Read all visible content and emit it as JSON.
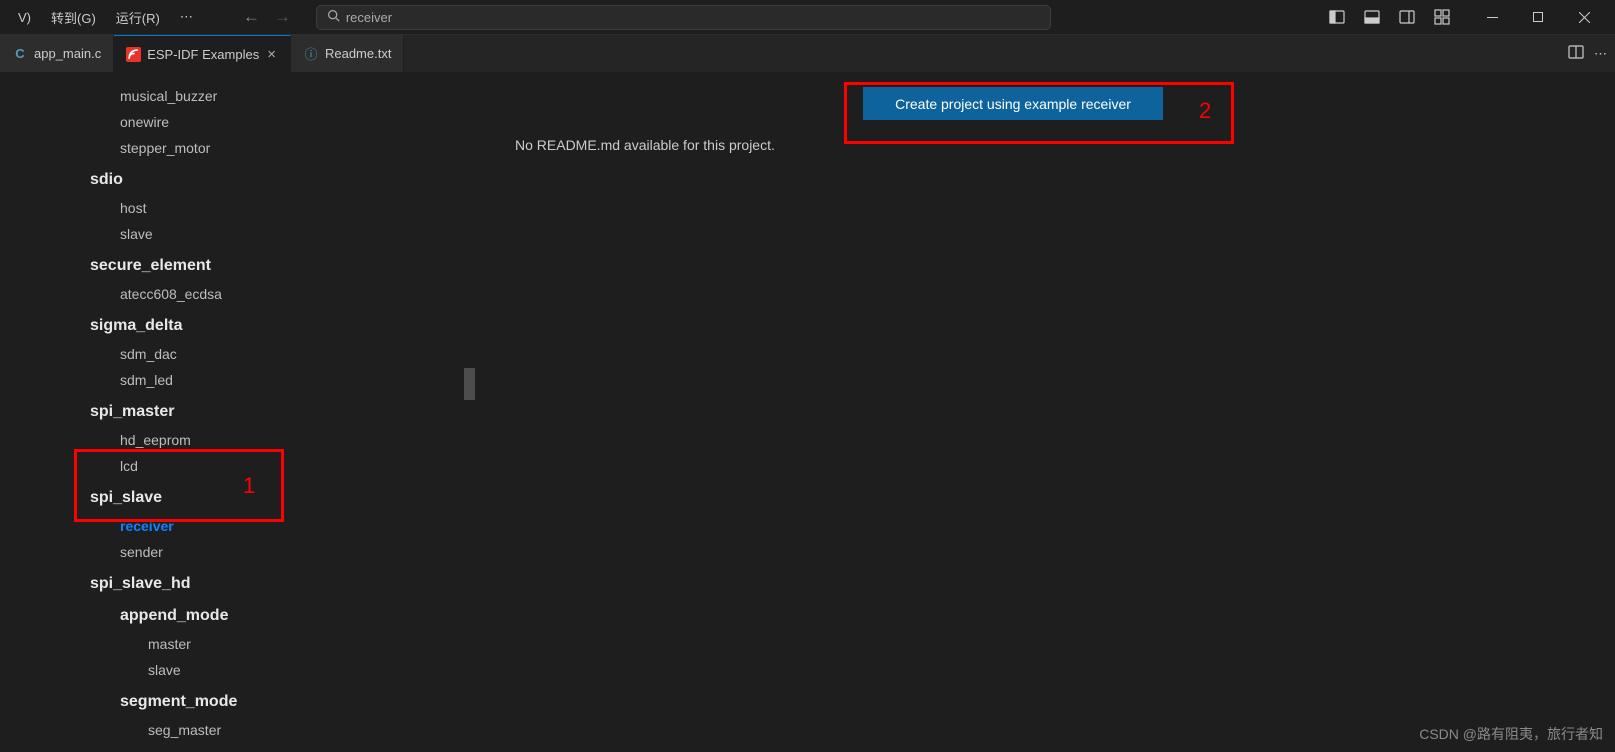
{
  "menu": {
    "goto": "转到(G)",
    "run": "运行(R)",
    "cropped": "V)"
  },
  "search": {
    "value": "receiver"
  },
  "tabs": [
    {
      "label": "app_main.c",
      "icon": "C",
      "active": false
    },
    {
      "label": "ESP-IDF Examples",
      "icon": "espressif",
      "active": true
    },
    {
      "label": "Readme.txt",
      "icon": "info",
      "active": false
    }
  ],
  "tree": [
    {
      "label": "musical_buzzer",
      "level": "level-1"
    },
    {
      "label": "onewire",
      "level": "level-1"
    },
    {
      "label": "stepper_motor",
      "level": "level-1"
    },
    {
      "label": "sdio",
      "level": "level-0"
    },
    {
      "label": "host",
      "level": "level-1"
    },
    {
      "label": "slave",
      "level": "level-1"
    },
    {
      "label": "secure_element",
      "level": "level-0"
    },
    {
      "label": "atecc608_ecdsa",
      "level": "level-1"
    },
    {
      "label": "sigma_delta",
      "level": "level-0"
    },
    {
      "label": "sdm_dac",
      "level": "level-1"
    },
    {
      "label": "sdm_led",
      "level": "level-1"
    },
    {
      "label": "spi_master",
      "level": "level-0"
    },
    {
      "label": "hd_eeprom",
      "level": "level-1"
    },
    {
      "label": "lcd",
      "level": "level-1"
    },
    {
      "label": "spi_slave",
      "level": "level-0"
    },
    {
      "label": "receiver",
      "level": "level-1",
      "selected": true
    },
    {
      "label": "sender",
      "level": "level-1"
    },
    {
      "label": "spi_slave_hd",
      "level": "level-0"
    },
    {
      "label": "append_mode",
      "level": "level-1b"
    },
    {
      "label": "master",
      "level": "level-2"
    },
    {
      "label": "slave",
      "level": "level-2"
    },
    {
      "label": "segment_mode",
      "level": "level-1b"
    },
    {
      "label": "seg_master",
      "level": "level-2"
    }
  ],
  "content": {
    "no_readme": "No README.md available for this project.",
    "create_button": "Create project using example receiver"
  },
  "annotations": {
    "one": "1",
    "two": "2"
  },
  "watermark": "CSDN @路有阻夷，旅行者知"
}
